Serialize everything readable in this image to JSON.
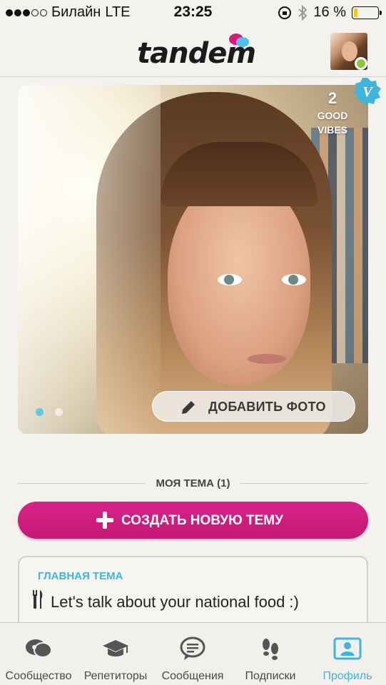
{
  "status_bar": {
    "carrier": "Билайн",
    "network": "LTE",
    "time": "23:25",
    "battery_percent": "16 %",
    "battery_level": 0.16
  },
  "header": {
    "logo": "tandem"
  },
  "profile": {
    "good_vibes_count": "2",
    "good_vibes_label_1": "GOOD",
    "good_vibes_label_2": "VIBES",
    "add_photo_label": "ДОБАВИТЬ ФОТО",
    "photo_pages": 2,
    "photo_active_page": 1
  },
  "topics": {
    "section_title": "МОЯ ТЕМА (1)",
    "create_label": "СОЗДАТЬ НОВУЮ ТЕМУ",
    "items": [
      {
        "tag": "ГЛАВНАЯ ТЕМА",
        "text": "Let's talk about your national food :)",
        "icon": "fork-knife-icon"
      }
    ]
  },
  "tab_bar": {
    "items": [
      {
        "label": "Сообщество",
        "icon": "community-icon"
      },
      {
        "label": "Репетиторы",
        "icon": "graduation-cap-icon"
      },
      {
        "label": "Сообщения",
        "icon": "chat-bubble-icon"
      },
      {
        "label": "Подписки",
        "icon": "footprints-icon"
      },
      {
        "label": "Профиль",
        "icon": "profile-card-icon",
        "active": true
      }
    ]
  },
  "colors": {
    "accent_pink": "#c51776",
    "accent_blue": "#3db5dd",
    "online_green": "#8cc63f",
    "battery_yellow": "#f3c21b"
  }
}
